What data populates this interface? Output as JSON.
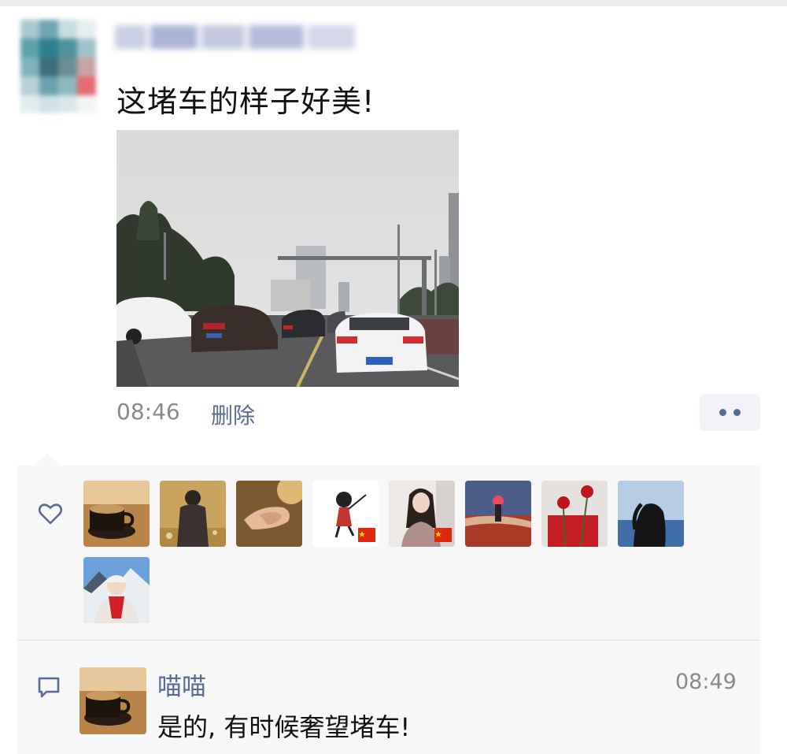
{
  "post": {
    "text": "这堵车的样子好美!",
    "time": "08:46",
    "delete_label": "删除",
    "more_icon": "more-dots-icon"
  },
  "likes": {
    "icon": "heart-outline-icon",
    "count_shown": 9
  },
  "comment": {
    "icon": "comment-bubble-icon",
    "author": "喵喵",
    "time": "08:49",
    "text": "是的, 有时候奢望堵车!"
  },
  "colors": {
    "link": "#576b95",
    "panel_bg": "#f7f7f7",
    "time_gray": "#8a8a8a"
  }
}
